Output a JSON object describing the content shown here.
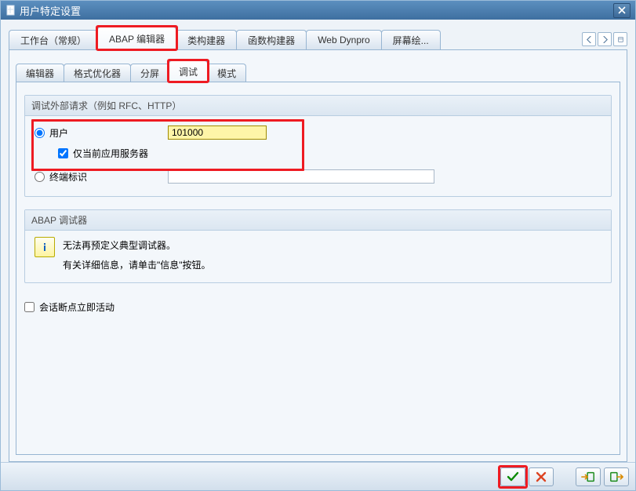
{
  "window": {
    "title": "用户特定设置"
  },
  "top_tabs": {
    "items": [
      {
        "label": "工作台（常规）"
      },
      {
        "label": "ABAP 编辑器"
      },
      {
        "label": "类构建器"
      },
      {
        "label": "函数构建器"
      },
      {
        "label": "Web Dynpro"
      },
      {
        "label": "屏幕绘..."
      }
    ],
    "active_index": 1
  },
  "sub_tabs": {
    "items": [
      {
        "label": "编辑器"
      },
      {
        "label": "格式优化器"
      },
      {
        "label": "分屏"
      },
      {
        "label": "调试"
      },
      {
        "label": "模式"
      }
    ],
    "active_index": 3
  },
  "debug_ext": {
    "legend": "调试外部请求（例如 RFC、HTTP）",
    "user_radio_label": "用户",
    "user_value": "101000",
    "only_current_label": "仅当前应用服务器",
    "only_current_checked": true,
    "terminal_radio_label": "终端标识",
    "terminal_value": "",
    "selected_radio": "user"
  },
  "abap_debugger": {
    "legend": "ABAP 调试器",
    "line1": "无法再预定义典型调试器。",
    "line2": "有关详细信息，请单击\"信息\"按钮。"
  },
  "session_bp": {
    "label": "会话断点立即活动",
    "checked": false
  },
  "icons": {
    "doc": "document-icon",
    "close": "close-icon",
    "left": "nav-left-icon",
    "right": "nav-right-icon",
    "list": "tab-list-icon",
    "info": "info-icon",
    "ok": "ok-check-icon",
    "cancel": "cancel-x-icon",
    "in": "transport-in-icon",
    "out": "transport-out-icon"
  }
}
